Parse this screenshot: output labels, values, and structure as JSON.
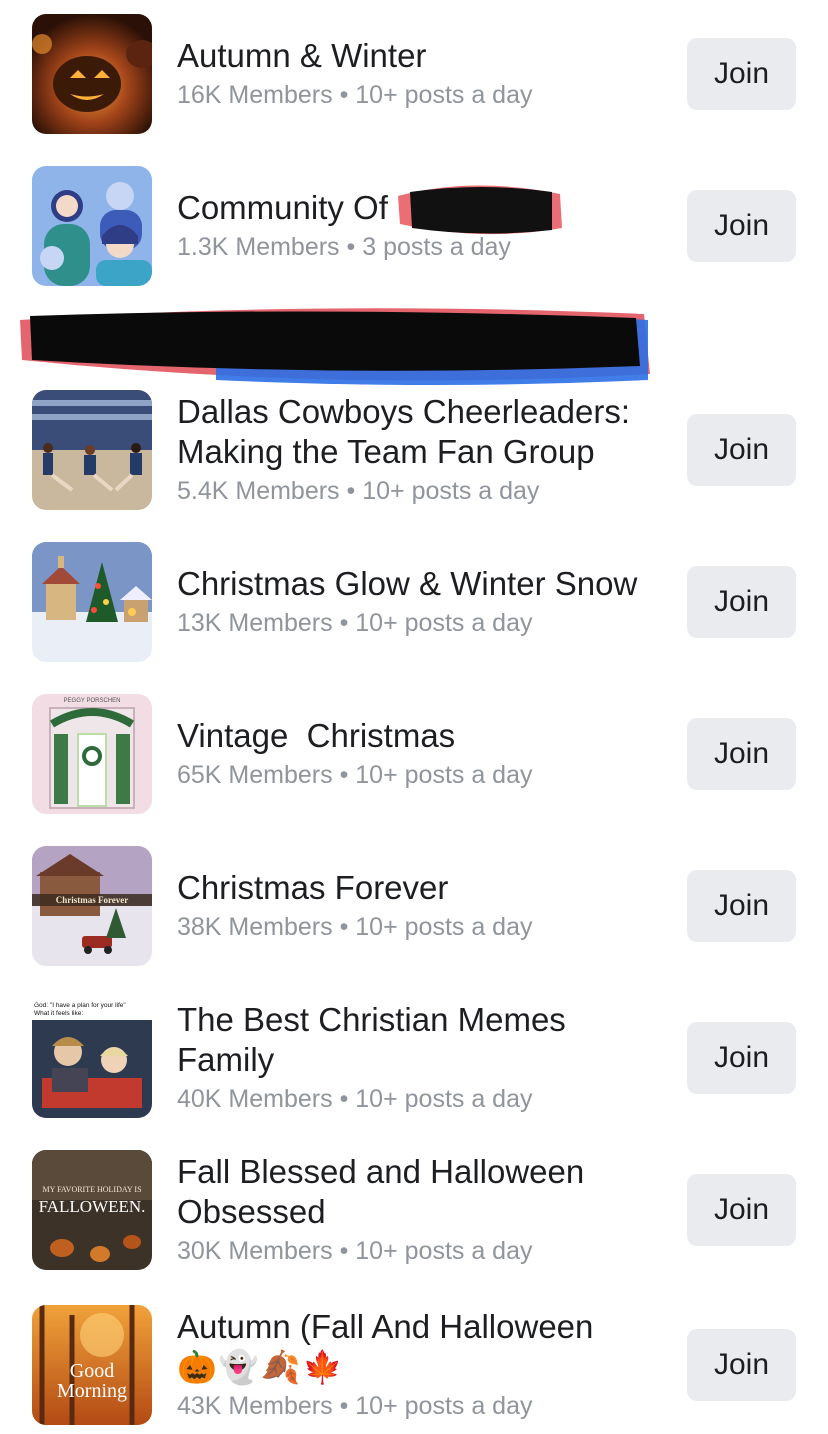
{
  "groups": [
    {
      "title": "Autumn & Winter",
      "members": "16K Members",
      "activity": "10+ posts a day",
      "join": "Join",
      "thumb": "pumpkin-image"
    },
    {
      "title": "Community Of",
      "members": "1.3K Members",
      "activity": "3 posts a day",
      "join": "Join",
      "thumb": "illustrated-people-image"
    },
    {
      "title": "Dallas Cowboys Cheerleaders: Making the Team Fan Group",
      "members": "5.4K Members",
      "activity": "10+ posts a day",
      "join": "Join",
      "thumb": "cheerleaders-image"
    },
    {
      "title": "Christmas Glow & Winter Snow",
      "members": "13K Members",
      "activity": "10+ posts a day",
      "join": "Join",
      "thumb": "snowy-village-image"
    },
    {
      "title": "Vintage  Christmas",
      "members": "65K Members",
      "activity": "10+ posts a day",
      "join": "Join",
      "thumb": "storefront-image"
    },
    {
      "title": "Christmas Forever",
      "members": "38K Members",
      "activity": "10+ posts a day",
      "join": "Join",
      "thumb": "christmas-house-image"
    },
    {
      "title": "The Best Christian Memes Family",
      "members": "40K Members",
      "activity": "10+ posts a day",
      "join": "Join",
      "thumb": "rollercoaster-meme-image"
    },
    {
      "title": "Fall Blessed and Halloween Obsessed",
      "members": "30K Members",
      "activity": "10+ posts a day",
      "join": "Join",
      "thumb": "falloween-image"
    },
    {
      "title": "Autumn (Fall And Halloween",
      "emoji": "🎃👻🍂🍁",
      "members": "43K Members",
      "activity": "10+ posts a day",
      "join": "Join",
      "thumb": "good-morning-autumn-image"
    }
  ],
  "thumb_text": {
    "falloween_small": "MY FAVORITE HOLIDAY IS",
    "falloween_big": "FALLOWEEN.",
    "forever_banner": "Christmas Forever",
    "meme_caption_1": "God: \"I have a plan for your life\"",
    "meme_caption_2": "What it feels like:",
    "good": "Good",
    "morning": "Morning",
    "store_sign": "PEGGY PORSCHEN"
  },
  "separator": " • "
}
